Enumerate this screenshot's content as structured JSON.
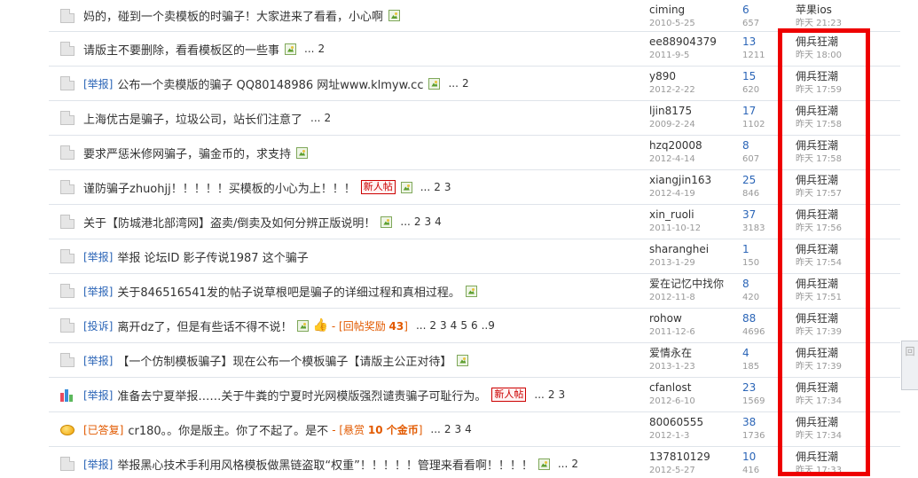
{
  "threads": [
    {
      "icon": "doc",
      "tag": "",
      "tag_color": "",
      "title": "妈的，碰到一个卖模板的时骗子！大家进来了看看，小心啊",
      "img": true,
      "new": "",
      "thumb": false,
      "bracket": "",
      "bracket_num": "",
      "pages": [],
      "author": "ciming",
      "date": "2010-5-25",
      "replies": "6",
      "views": "657",
      "last_user": "苹果ios",
      "last_time": "昨天 21:23"
    },
    {
      "icon": "doc",
      "tag": "",
      "tag_color": "",
      "title": "请版主不要删除，看看模板区的一些事",
      "img": true,
      "new": "",
      "thumb": false,
      "bracket": "",
      "bracket_num": "",
      "pages": [
        "...",
        "2"
      ],
      "author": "ee88904379",
      "date": "2011-9-5",
      "replies": "13",
      "views": "1211",
      "last_user": "佣兵狂潮",
      "last_time": "昨天 18:00"
    },
    {
      "icon": "doc",
      "tag": "[举报]",
      "tag_color": "blue",
      "title": "公布一个卖模版的骗子 QQ80148986 网址www.klmyw.cc",
      "img": true,
      "new": "",
      "thumb": false,
      "bracket": "",
      "bracket_num": "",
      "pages": [
        "...",
        "2"
      ],
      "author": "y890",
      "date": "2012-2-22",
      "replies": "15",
      "views": "620",
      "last_user": "佣兵狂潮",
      "last_time": "昨天 17:59"
    },
    {
      "icon": "doc",
      "tag": "",
      "tag_color": "",
      "title": "上海优古是骗子，垃圾公司，站长们注意了",
      "img": false,
      "new": "",
      "thumb": false,
      "bracket": "",
      "bracket_num": "",
      "pages": [
        "...",
        "2"
      ],
      "author": "ljin8175",
      "date": "2009-2-24",
      "replies": "17",
      "views": "1102",
      "last_user": "佣兵狂潮",
      "last_time": "昨天 17:58"
    },
    {
      "icon": "doc",
      "tag": "",
      "tag_color": "",
      "title": "要求严惩米修网骗子，骗金币的，求支持",
      "img": true,
      "new": "",
      "thumb": false,
      "bracket": "",
      "bracket_num": "",
      "pages": [],
      "author": "hzq20008",
      "date": "2012-4-14",
      "replies": "8",
      "views": "607",
      "last_user": "佣兵狂潮",
      "last_time": "昨天 17:58"
    },
    {
      "icon": "doc",
      "tag": "",
      "tag_color": "",
      "title": "谨防骗子zhuohjj！！！！！买模板的小心为上！！！",
      "img": true,
      "new": "新人帖",
      "thumb": false,
      "bracket": "",
      "bracket_num": "",
      "pages": [
        "...",
        "2",
        "3"
      ],
      "author": "xiangjin163",
      "date": "2012-4-19",
      "replies": "25",
      "views": "846",
      "last_user": "佣兵狂潮",
      "last_time": "昨天 17:57"
    },
    {
      "icon": "doc",
      "tag": "",
      "tag_color": "",
      "title": "关于【防城港北部湾网】盗卖/倒卖及如何分辨正版说明！",
      "img": true,
      "new": "",
      "thumb": false,
      "bracket": "",
      "bracket_num": "",
      "pages": [
        "...",
        "2",
        "3",
        "4"
      ],
      "author": "xin_ruoli",
      "date": "2011-10-12",
      "replies": "37",
      "views": "3183",
      "last_user": "佣兵狂潮",
      "last_time": "昨天 17:56"
    },
    {
      "icon": "doc",
      "tag": "[举报]",
      "tag_color": "blue",
      "title": "举报 论坛ID 影子传说1987 这个骗子",
      "img": false,
      "new": "",
      "thumb": false,
      "bracket": "",
      "bracket_num": "",
      "pages": [],
      "author": "sharanghei",
      "date": "2013-1-29",
      "replies": "1",
      "views": "150",
      "last_user": "佣兵狂潮",
      "last_time": "昨天 17:54"
    },
    {
      "icon": "doc",
      "tag": "[举报]",
      "tag_color": "blue",
      "title": "关于846516541发的帖子说草根吧是骗子的详细过程和真相过程。",
      "img": true,
      "new": "",
      "thumb": false,
      "bracket": "",
      "bracket_num": "",
      "pages": [],
      "author": "爱在记忆中找你",
      "date": "2012-11-8",
      "replies": "8",
      "views": "420",
      "last_user": "佣兵狂潮",
      "last_time": "昨天 17:51"
    },
    {
      "icon": "doc",
      "tag": "[投诉]",
      "tag_color": "blue",
      "title": "离开dz了，但是有些话不得不说！",
      "img": true,
      "new": "",
      "thumb": true,
      "bracket": "- [回帖奖励",
      "bracket_num": "43",
      "pages": [
        "...",
        "2",
        "3",
        "4",
        "5",
        "6",
        "..9"
      ],
      "author": "rohow",
      "date": "2011-12-6",
      "replies": "88",
      "views": "4696",
      "last_user": "佣兵狂潮",
      "last_time": "昨天 17:39"
    },
    {
      "icon": "doc",
      "tag": "[举报]",
      "tag_color": "blue",
      "title": "【一个仿制模板骗子】现在公布一个模板骗子【请版主公正对待】",
      "img": true,
      "new": "",
      "thumb": false,
      "bracket": "",
      "bracket_num": "",
      "pages": [],
      "author": "爱情永在",
      "date": "2013-1-23",
      "replies": "4",
      "views": "185",
      "last_user": "佣兵狂潮",
      "last_time": "昨天 17:39"
    },
    {
      "icon": "poll",
      "tag": "[举报]",
      "tag_color": "blue",
      "title": "准备去宁夏举报……关于牛粪的宁夏时光网模版强烈谴责骗子可耻行为。",
      "img": false,
      "new": "新人帖",
      "thumb": false,
      "bracket": "",
      "bracket_num": "",
      "pages": [
        "...",
        "2",
        "3"
      ],
      "author": "cfanlost",
      "date": "2012-6-10",
      "replies": "23",
      "views": "1569",
      "last_user": "佣兵狂潮",
      "last_time": "昨天 17:34"
    },
    {
      "icon": "reward",
      "tag": "[已答复]",
      "tag_color": "orange",
      "title": "cr180。。你是版主。你了不起了。是不",
      "img": false,
      "new": "",
      "thumb": false,
      "bracket": "- [悬赏",
      "bracket_num": "10 个金币",
      "pages": [
        "...",
        "2",
        "3",
        "4"
      ],
      "author": "80060555",
      "date": "2012-1-3",
      "replies": "38",
      "views": "1736",
      "last_user": "佣兵狂潮",
      "last_time": "昨天 17:34"
    },
    {
      "icon": "doc",
      "tag": "[举报]",
      "tag_color": "blue",
      "title": "举报黑心技术手利用风格模板做黑链盗取“权重”！！！！！管理来看看啊！！！！",
      "img": true,
      "new": "",
      "thumb": false,
      "bracket": "",
      "bracket_num": "",
      "pages": [
        "...",
        "2"
      ],
      "author": "137810129",
      "date": "2012-5-27",
      "replies": "10",
      "views": "416",
      "last_user": "佣兵狂潮",
      "last_time": "昨天 17:33"
    }
  ],
  "side_tab": {
    "label": "回"
  },
  "colors": {
    "link": "#2b65b7",
    "muted": "#999999",
    "highlight": "#ee0000",
    "tag_orange": "#e25a00"
  }
}
